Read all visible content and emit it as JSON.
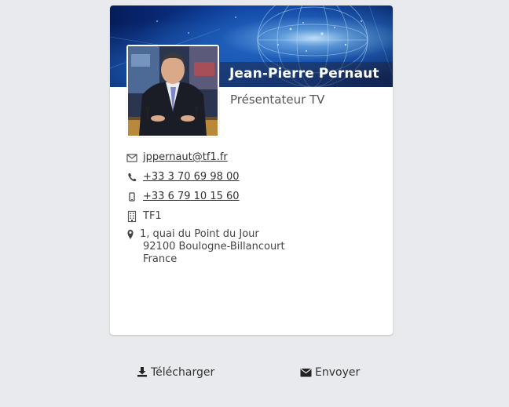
{
  "contact": {
    "name": "Jean-Pierre Pernaut",
    "job_title": "Présentateur TV",
    "email": "jppernaut@tf1.fr",
    "phone": "+33 3 70 69 98 00",
    "mobile": "+33 6 79 10 15 60",
    "company": "TF1",
    "address": {
      "line1": "1, quai du Point du Jour",
      "line2": "92100 Boulogne-Billancourt",
      "line3": "France"
    }
  },
  "icons": {
    "email": "envelope-icon",
    "phone": "phone-icon",
    "mobile": "mobile-icon",
    "company": "building-icon",
    "address": "map-marker-icon",
    "download": "download-icon",
    "send": "envelope-solid-icon"
  },
  "actions": {
    "download_label": "Télécharger",
    "send_label": "Envoyer"
  }
}
